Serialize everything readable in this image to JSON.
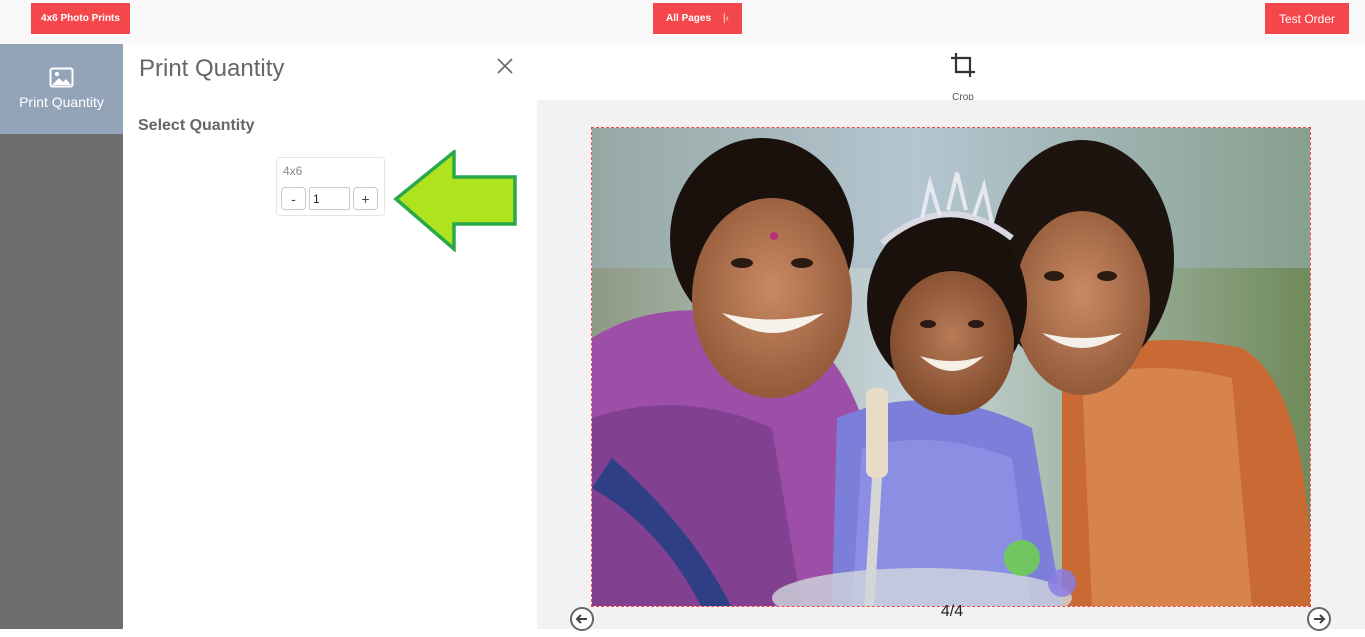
{
  "topbar": {
    "product_label": "4x6 Photo Prints",
    "all_pages_label": "All Pages",
    "test_order_label": "Test Order"
  },
  "sidebar": {
    "items": [
      {
        "label": "Print Quantity",
        "icon": "image-icon",
        "active": true
      }
    ]
  },
  "panel": {
    "title": "Print Quantity",
    "section_title": "Select Quantity",
    "quantity": {
      "size_label": "4x6",
      "value": "1",
      "decrement_label": "-",
      "increment_label": "+"
    }
  },
  "toolbar": {
    "tools": [
      {
        "label": "Crop",
        "icon": "crop-icon"
      }
    ]
  },
  "canvas": {
    "page_counter": "4/4"
  },
  "colors": {
    "accent": "#f4474b",
    "rail_bg": "#6e6e6e",
    "rail_active": "#93a4b8",
    "callout_arrow": "#aee31e",
    "callout_border": "#2aa84a"
  }
}
